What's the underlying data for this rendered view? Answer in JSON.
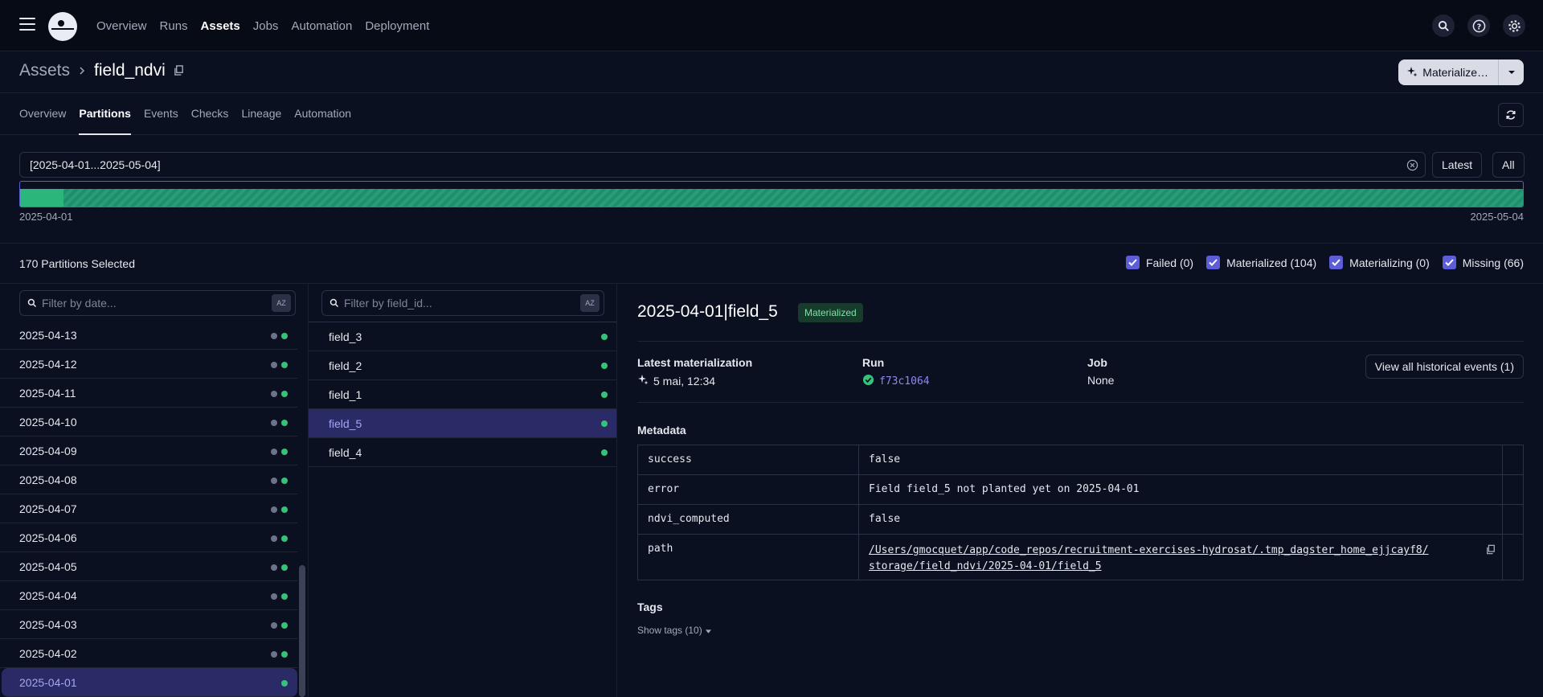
{
  "nav": {
    "links": [
      "Overview",
      "Runs",
      "Assets",
      "Jobs",
      "Automation",
      "Deployment"
    ],
    "active": "Assets"
  },
  "header": {
    "root": "Assets",
    "asset": "field_ndvi",
    "materialize_label": "Materialize…"
  },
  "tabs": [
    "Overview",
    "Partitions",
    "Events",
    "Checks",
    "Lineage",
    "Automation"
  ],
  "range": {
    "value": "[2025-04-01...2025-05-04]",
    "latest_label": "Latest",
    "all_label": "All",
    "start_date": "2025-04-01",
    "end_date": "2025-05-04"
  },
  "selection": {
    "count_label": "170 Partitions Selected",
    "statuses": [
      {
        "label": "Failed (0)"
      },
      {
        "label": "Materialized (104)"
      },
      {
        "label": "Materializing (0)"
      },
      {
        "label": "Missing (66)"
      }
    ]
  },
  "date_column": {
    "filter_placeholder": "Filter by date...",
    "sort_label": "AZ",
    "rows": [
      {
        "date": "2025-04-13",
        "missing": true
      },
      {
        "date": "2025-04-12",
        "missing": true
      },
      {
        "date": "2025-04-11",
        "missing": true
      },
      {
        "date": "2025-04-10",
        "missing": true
      },
      {
        "date": "2025-04-09",
        "missing": true
      },
      {
        "date": "2025-04-08",
        "missing": true
      },
      {
        "date": "2025-04-07",
        "missing": true
      },
      {
        "date": "2025-04-06",
        "missing": true
      },
      {
        "date": "2025-04-05",
        "missing": true
      },
      {
        "date": "2025-04-04",
        "missing": true
      },
      {
        "date": "2025-04-03",
        "missing": true
      },
      {
        "date": "2025-04-02",
        "missing": true
      },
      {
        "date": "2025-04-01",
        "missing": false,
        "selected": true
      }
    ]
  },
  "field_column": {
    "filter_placeholder": "Filter by field_id...",
    "sort_label": "AZ",
    "rows": [
      {
        "name": "field_3"
      },
      {
        "name": "field_2"
      },
      {
        "name": "field_1"
      },
      {
        "name": "field_5",
        "selected": true
      },
      {
        "name": "field_4"
      }
    ]
  },
  "detail": {
    "title": "2025-04-01|field_5",
    "status_badge": "Materialized",
    "latest_label": "Latest materialization",
    "latest_value": "5 mai, 12:34",
    "run_label": "Run",
    "run_id": "f73c1064",
    "job_label": "Job",
    "job_value": "None",
    "history_button": "View all historical events (1)",
    "metadata_label": "Metadata",
    "metadata": [
      {
        "key": "success",
        "value": "false"
      },
      {
        "key": "error",
        "value": "Field field_5 not planted yet on 2025-04-01"
      },
      {
        "key": "ndvi_computed",
        "value": "false"
      }
    ],
    "path_key": "path",
    "path_line1": "/Users/gmocquet/app/code_repos/recruitment-exercises-hydrosat/.tmp_dagster_home_ejjcayf8/",
    "path_line2": "storage/field_ndvi/2025-04-01/field_5",
    "tags_label": "Tags",
    "show_tags": "Show tags (10)"
  },
  "colors": {
    "accent": "#5d5dd8",
    "success": "#35c37a",
    "selected_row": "#2a2a66"
  }
}
